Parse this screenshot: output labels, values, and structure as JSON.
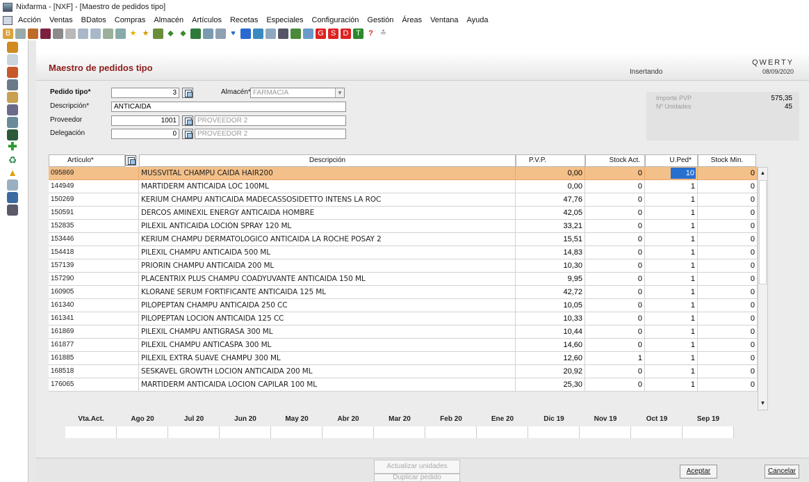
{
  "window": {
    "title": "Nixfarma - [NXF] - [Maestro de pedidos tipo]"
  },
  "menu": [
    "Acción",
    "Ventas",
    "BDatos",
    "Compras",
    "Almacén",
    "Artículos",
    "Recetas",
    "Especiales",
    "Configuración",
    "Gestión",
    "Áreas",
    "Ventana",
    "Ayuda"
  ],
  "form": {
    "title": "Maestro de pedidos tipo",
    "mode": "Insertando",
    "company": "QWERTY",
    "date": "08/09/2020"
  },
  "fields": {
    "pedido_tipo_label": "Pedido tipo*",
    "pedido_tipo_value": "3",
    "almacen_label": "Almacén*",
    "almacen_value": "FARMACIA",
    "descripcion_label": "Descripción*",
    "descripcion_value": "ANTICAIDA",
    "proveedor_label": "Proveedor",
    "proveedor_code": "1001",
    "proveedor_name": "PROVEEDOR 2",
    "delegacion_label": "Delegación",
    "delegacion_code": "0",
    "delegacion_name": "PROVEEDOR 2"
  },
  "totals": {
    "importe_label": "Importe PVP",
    "importe_value": "575,35",
    "unidades_label": "Nº Unidades",
    "unidades_value": "45"
  },
  "grid": {
    "headers": [
      "Artículo*",
      "Descripción",
      "P.V.P.",
      "Stock Act.",
      "U.Ped*",
      "Stock Min."
    ],
    "rows": [
      {
        "code": "095869",
        "desc": "MUSSVITAL CHAMPU CAIDA HAIR200",
        "pvp": "0,00",
        "stock": "0",
        "uped": "10",
        "min": "0"
      },
      {
        "code": "144949",
        "desc": "MARTIDERM ANTICAIDA LOC 100ML",
        "pvp": "0,00",
        "stock": "0",
        "uped": "1",
        "min": "0"
      },
      {
        "code": "150269",
        "desc": "KERIUM CHAMPU ANTICAIDA  MADECASSOSIDETTO INTENS LA ROC",
        "pvp": "47,76",
        "stock": "0",
        "uped": "1",
        "min": "0"
      },
      {
        "code": "150591",
        "desc": "DERCOS AMINEXIL ENERGY ANTICAIDA HOMBRE",
        "pvp": "42,05",
        "stock": "0",
        "uped": "1",
        "min": "0"
      },
      {
        "code": "152835",
        "desc": "PILEXIL ANTICAIDA LOCION  SPRAY 120 ML",
        "pvp": "33,21",
        "stock": "0",
        "uped": "1",
        "min": "0"
      },
      {
        "code": "153446",
        "desc": "KERIUM CHAMPU DERMATOLOGICO ANTICAIDA LA ROCHE POSAY 2",
        "pvp": "15,51",
        "stock": "0",
        "uped": "1",
        "min": "0"
      },
      {
        "code": "154418",
        "desc": "PILEXIL CHAMPU ANTICAIDA  500 ML",
        "pvp": "14,83",
        "stock": "0",
        "uped": "1",
        "min": "0"
      },
      {
        "code": "157139",
        "desc": "PRIORIN CHAMPU ANTICAIDA 200 ML",
        "pvp": "10,30",
        "stock": "0",
        "uped": "1",
        "min": "0"
      },
      {
        "code": "157290",
        "desc": "PLACENTRIX PLUS CHAMPU COADYUVANTE ANTICAIDA  150 ML",
        "pvp": "9,95",
        "stock": "0",
        "uped": "1",
        "min": "0"
      },
      {
        "code": "160905",
        "desc": "KLORANE SERUM FORTIFICANTE ANTICAIDA  125 ML",
        "pvp": "42,72",
        "stock": "0",
        "uped": "1",
        "min": "0"
      },
      {
        "code": "161340",
        "desc": "PILOPEPTAN CHAMPU ANTICAIDA  250 CC",
        "pvp": "10,05",
        "stock": "0",
        "uped": "1",
        "min": "0"
      },
      {
        "code": "161341",
        "desc": "PILOPEPTAN LOCION ANTICAIDA  125 CC",
        "pvp": "10,33",
        "stock": "0",
        "uped": "1",
        "min": "0"
      },
      {
        "code": "161869",
        "desc": "PILEXIL CHAMPU ANTIGRASA  300 ML",
        "pvp": "10,44",
        "stock": "0",
        "uped": "1",
        "min": "0"
      },
      {
        "code": "161877",
        "desc": "PILEXIL CHAMPU ANTICASPA  300 ML",
        "pvp": "14,60",
        "stock": "0",
        "uped": "1",
        "min": "0"
      },
      {
        "code": "161885",
        "desc": "PILEXIL EXTRA SUAVE CHAMPU  300 ML",
        "pvp": "12,60",
        "stock": "1",
        "uped": "1",
        "min": "0"
      },
      {
        "code": "168518",
        "desc": "SESKAVEL GROWTH LOCION ANTICAIDA  200 ML",
        "pvp": "20,92",
        "stock": "0",
        "uped": "1",
        "min": "0"
      },
      {
        "code": "176065",
        "desc": "MARTIDERM ANTICAIDA LOCION CAPILAR  100 ML",
        "pvp": "25,30",
        "stock": "0",
        "uped": "1",
        "min": "0"
      }
    ]
  },
  "months": [
    "Vta.Act.",
    "Ago 20",
    "Jul 20",
    "Jun 20",
    "May 20",
    "Abr 20",
    "Mar 20",
    "Feb 20",
    "Ene 20",
    "Dic 19",
    "Nov 19",
    "Oct 19",
    "Sep 19"
  ],
  "buttons": {
    "actualizar": "Actualizar unidades",
    "duplicar": "Duplicar pedido",
    "aceptar": "Aceptar",
    "cancelar": "Cancelar"
  },
  "colors": {
    "title": "#8c1d1d",
    "selected_row": "#f4c089",
    "selected_cell": "#2770d0"
  }
}
